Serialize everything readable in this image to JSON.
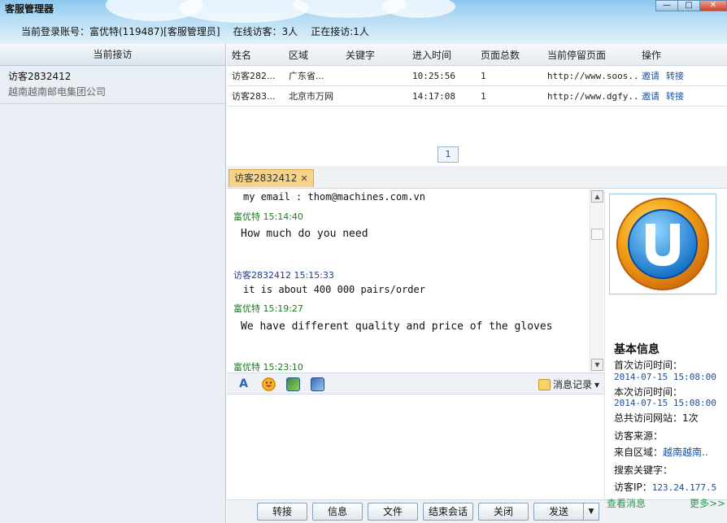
{
  "window": {
    "title": "客服管理器",
    "controls": {
      "minimize": "—",
      "maximize": "□",
      "close": "✕"
    }
  },
  "header": {
    "account_label": "当前登录账号：富优特(119487)[客服管理员]",
    "online_label": "在线访客：3人",
    "receiving_label": "正在接访:1人"
  },
  "left": {
    "heading": "当前接访",
    "visitors": [
      {
        "name": "访客2832412",
        "org": "越南越南邮电集团公司"
      }
    ]
  },
  "table": {
    "headers": [
      "姓名",
      "区域",
      "关键字",
      "进入时间",
      "页面总数",
      "当前停留页面",
      "操作"
    ],
    "rows": [
      {
        "name": "访客282...",
        "region": "广东省...",
        "keyword": "",
        "time": "10:25:56",
        "pages": "1",
        "page": "http://www.soos...",
        "invite": "邀请",
        "transfer": "转接"
      },
      {
        "name": "访客283...",
        "region": "北京市万网",
        "keyword": "",
        "time": "14:17:08",
        "pages": "1",
        "page": "http://www.dgfy...",
        "invite": "邀请",
        "transfer": "转接"
      }
    ],
    "page_number": "1"
  },
  "chat_tab": {
    "label": "访客2832412",
    "close": "✕"
  },
  "chat": {
    "lines": [
      {
        "kind": "text",
        "text": "my email : thom@machines.com.vn"
      },
      {
        "kind": "me",
        "text": "富优特  15:14:40"
      },
      {
        "kind": "text",
        "text": "How much do you need"
      },
      {
        "kind": "visitor",
        "text": "访客2832412  15:15:33"
      },
      {
        "kind": "text",
        "text": "it is about 400 000 pairs/order"
      },
      {
        "kind": "me",
        "text": "富优特  15:19:27"
      },
      {
        "kind": "text",
        "text": "We have different quality and price of the gloves"
      },
      {
        "kind": "me",
        "text": "富优特  15:23:10"
      }
    ]
  },
  "toolbar": {
    "font_icon": "A",
    "history_label": "消息记录",
    "history_arrow": "▾"
  },
  "buttons": {
    "transfer": "转接",
    "info": "信息",
    "file": "文件",
    "end": "结束会话",
    "close": "关闭",
    "send": "发送",
    "send_arrow": "▼"
  },
  "info": {
    "title": "基本信息",
    "first_visit_label": "首次访问时间：",
    "first_visit_value": "2014-07-15 15:08:00",
    "this_visit_label": "本次访问时间：",
    "this_visit_value": "2014-07-15 15:08:00",
    "sites_label": "总共访问网站：",
    "sites_value": "1次",
    "source_label": "访客来源：",
    "region_label": "来自区域：",
    "region_value": "越南越南..",
    "keyword_label": "搜索关键字：",
    "ip_label": "访客IP：",
    "ip_value": "123.24.177.5",
    "view_messages": "查看消息",
    "more": "更多>>"
  },
  "colors": {
    "header_top": "#8cc8ee",
    "me_sender": "#1a7a1a",
    "visitor_sender": "#1a3a9a",
    "link": "#1a4fa0",
    "tab_active": "#f5d48a"
  }
}
